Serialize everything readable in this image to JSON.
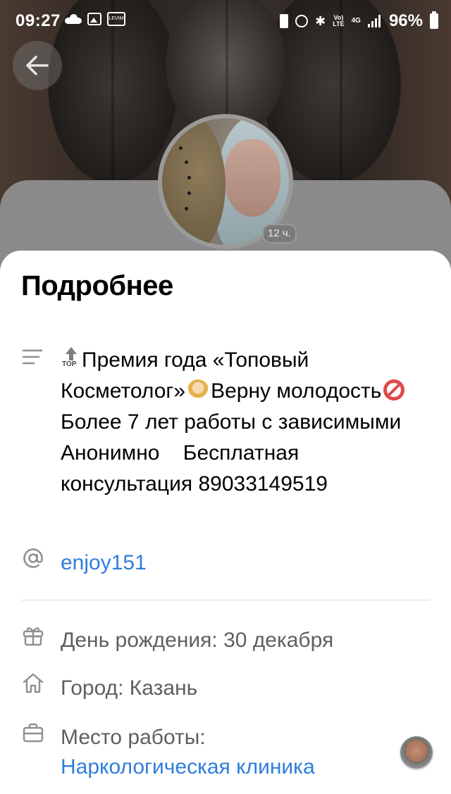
{
  "status_bar": {
    "time": "09:27",
    "app_icon_text": "LEVIM",
    "volte": "Vo)\nLTE",
    "network": "4G",
    "battery": "96%"
  },
  "profile": {
    "avatar_badge": "12 ч."
  },
  "sheet": {
    "title": "Подробнее",
    "status": {
      "top_label": "TOP",
      "part1": "Премия года «Топовый Косметолог»",
      "part2": "Верну молодость",
      "part3": "Более 7 лет работы с зависимыми Анонимно    Бесплатная консультация 89033149519"
    },
    "username": "enjoy151",
    "birthday": "День рождения: 30 декабря",
    "city": "Город: Казань",
    "work_label": "Место работы:",
    "work_value": "Наркологическая клиника"
  },
  "colors": {
    "link": "#2f7dde",
    "icon": "#8c8f94",
    "muted_text": "#5d5f63"
  },
  "icons": {
    "back": "arrow-left-icon",
    "status": "text-lines-icon",
    "username": "at-sign-icon",
    "birthday": "gift-icon",
    "city": "home-icon",
    "work": "briefcase-icon"
  }
}
